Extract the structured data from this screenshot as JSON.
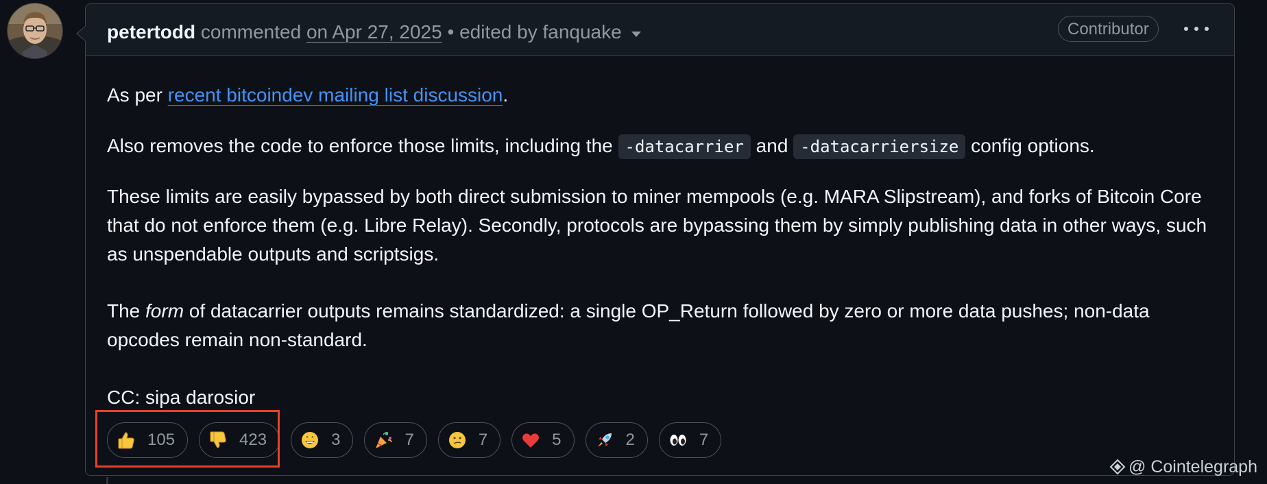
{
  "comment": {
    "author": "petertodd",
    "action": "commented",
    "date": "on Apr 27, 2025",
    "edited": "• edited by fanquake",
    "role_badge": "Contributor"
  },
  "body": {
    "p1_prefix": "As per ",
    "p1_link": "recent bitcoindev mailing list discussion",
    "p1_suffix": ".",
    "p2_a": "Also removes the code to enforce those limits, including the ",
    "p2_code1": "-datacarrier",
    "p2_b": " and ",
    "p2_code2": "-datacarriersize",
    "p2_c": " config options.",
    "p3": "These limits are easily bypassed by both direct submission to miner mempools (e.g. MARA Slipstream), and forks of Bitcoin Core that do not enforce them (e.g. Libre Relay). Secondly, protocols are bypassing them by simply publishing data in other ways, such as unspendable outputs and scriptsigs.",
    "p4_a": "The ",
    "p4_em": "form",
    "p4_b": " of datacarrier outputs remains standardized: a single OP_Return followed by zero or more data pushes; non-data opcodes remain non-standard.",
    "p5": "CC: sipa darosior"
  },
  "reactions": [
    {
      "emoji": "thumbs-up",
      "count": "105"
    },
    {
      "emoji": "thumbs-down",
      "count": "423"
    },
    {
      "emoji": "laugh",
      "count": "3"
    },
    {
      "emoji": "hooray",
      "count": "7"
    },
    {
      "emoji": "confused",
      "count": "7"
    },
    {
      "emoji": "heart",
      "count": "5"
    },
    {
      "emoji": "rocket",
      "count": "2"
    },
    {
      "emoji": "eyes",
      "count": "7"
    }
  ],
  "watermark": "@ Cointelegraph",
  "colors": {
    "background": "#0d1117",
    "link": "#4493f8",
    "highlight": "#e8402b"
  }
}
